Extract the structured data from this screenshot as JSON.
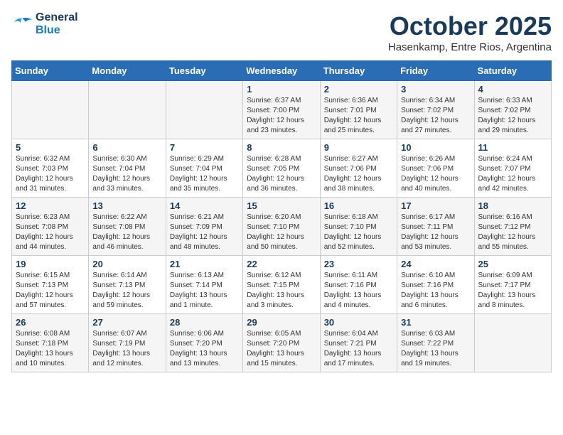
{
  "header": {
    "logo_line1": "General",
    "logo_line2": "Blue",
    "month": "October 2025",
    "location": "Hasenkamp, Entre Rios, Argentina"
  },
  "weekdays": [
    "Sunday",
    "Monday",
    "Tuesday",
    "Wednesday",
    "Thursday",
    "Friday",
    "Saturday"
  ],
  "weeks": [
    [
      {
        "day": "",
        "info": ""
      },
      {
        "day": "",
        "info": ""
      },
      {
        "day": "",
        "info": ""
      },
      {
        "day": "1",
        "info": "Sunrise: 6:37 AM\nSunset: 7:00 PM\nDaylight: 12 hours\nand 23 minutes."
      },
      {
        "day": "2",
        "info": "Sunrise: 6:36 AM\nSunset: 7:01 PM\nDaylight: 12 hours\nand 25 minutes."
      },
      {
        "day": "3",
        "info": "Sunrise: 6:34 AM\nSunset: 7:02 PM\nDaylight: 12 hours\nand 27 minutes."
      },
      {
        "day": "4",
        "info": "Sunrise: 6:33 AM\nSunset: 7:02 PM\nDaylight: 12 hours\nand 29 minutes."
      }
    ],
    [
      {
        "day": "5",
        "info": "Sunrise: 6:32 AM\nSunset: 7:03 PM\nDaylight: 12 hours\nand 31 minutes."
      },
      {
        "day": "6",
        "info": "Sunrise: 6:30 AM\nSunset: 7:04 PM\nDaylight: 12 hours\nand 33 minutes."
      },
      {
        "day": "7",
        "info": "Sunrise: 6:29 AM\nSunset: 7:04 PM\nDaylight: 12 hours\nand 35 minutes."
      },
      {
        "day": "8",
        "info": "Sunrise: 6:28 AM\nSunset: 7:05 PM\nDaylight: 12 hours\nand 36 minutes."
      },
      {
        "day": "9",
        "info": "Sunrise: 6:27 AM\nSunset: 7:06 PM\nDaylight: 12 hours\nand 38 minutes."
      },
      {
        "day": "10",
        "info": "Sunrise: 6:26 AM\nSunset: 7:06 PM\nDaylight: 12 hours\nand 40 minutes."
      },
      {
        "day": "11",
        "info": "Sunrise: 6:24 AM\nSunset: 7:07 PM\nDaylight: 12 hours\nand 42 minutes."
      }
    ],
    [
      {
        "day": "12",
        "info": "Sunrise: 6:23 AM\nSunset: 7:08 PM\nDaylight: 12 hours\nand 44 minutes."
      },
      {
        "day": "13",
        "info": "Sunrise: 6:22 AM\nSunset: 7:08 PM\nDaylight: 12 hours\nand 46 minutes."
      },
      {
        "day": "14",
        "info": "Sunrise: 6:21 AM\nSunset: 7:09 PM\nDaylight: 12 hours\nand 48 minutes."
      },
      {
        "day": "15",
        "info": "Sunrise: 6:20 AM\nSunset: 7:10 PM\nDaylight: 12 hours\nand 50 minutes."
      },
      {
        "day": "16",
        "info": "Sunrise: 6:18 AM\nSunset: 7:10 PM\nDaylight: 12 hours\nand 52 minutes."
      },
      {
        "day": "17",
        "info": "Sunrise: 6:17 AM\nSunset: 7:11 PM\nDaylight: 12 hours\nand 53 minutes."
      },
      {
        "day": "18",
        "info": "Sunrise: 6:16 AM\nSunset: 7:12 PM\nDaylight: 12 hours\nand 55 minutes."
      }
    ],
    [
      {
        "day": "19",
        "info": "Sunrise: 6:15 AM\nSunset: 7:13 PM\nDaylight: 12 hours\nand 57 minutes."
      },
      {
        "day": "20",
        "info": "Sunrise: 6:14 AM\nSunset: 7:13 PM\nDaylight: 12 hours\nand 59 minutes."
      },
      {
        "day": "21",
        "info": "Sunrise: 6:13 AM\nSunset: 7:14 PM\nDaylight: 13 hours\nand 1 minute."
      },
      {
        "day": "22",
        "info": "Sunrise: 6:12 AM\nSunset: 7:15 PM\nDaylight: 13 hours\nand 3 minutes."
      },
      {
        "day": "23",
        "info": "Sunrise: 6:11 AM\nSunset: 7:16 PM\nDaylight: 13 hours\nand 4 minutes."
      },
      {
        "day": "24",
        "info": "Sunrise: 6:10 AM\nSunset: 7:16 PM\nDaylight: 13 hours\nand 6 minutes."
      },
      {
        "day": "25",
        "info": "Sunrise: 6:09 AM\nSunset: 7:17 PM\nDaylight: 13 hours\nand 8 minutes."
      }
    ],
    [
      {
        "day": "26",
        "info": "Sunrise: 6:08 AM\nSunset: 7:18 PM\nDaylight: 13 hours\nand 10 minutes."
      },
      {
        "day": "27",
        "info": "Sunrise: 6:07 AM\nSunset: 7:19 PM\nDaylight: 13 hours\nand 12 minutes."
      },
      {
        "day": "28",
        "info": "Sunrise: 6:06 AM\nSunset: 7:20 PM\nDaylight: 13 hours\nand 13 minutes."
      },
      {
        "day": "29",
        "info": "Sunrise: 6:05 AM\nSunset: 7:20 PM\nDaylight: 13 hours\nand 15 minutes."
      },
      {
        "day": "30",
        "info": "Sunrise: 6:04 AM\nSunset: 7:21 PM\nDaylight: 13 hours\nand 17 minutes."
      },
      {
        "day": "31",
        "info": "Sunrise: 6:03 AM\nSunset: 7:22 PM\nDaylight: 13 hours\nand 19 minutes."
      },
      {
        "day": "",
        "info": ""
      }
    ]
  ]
}
